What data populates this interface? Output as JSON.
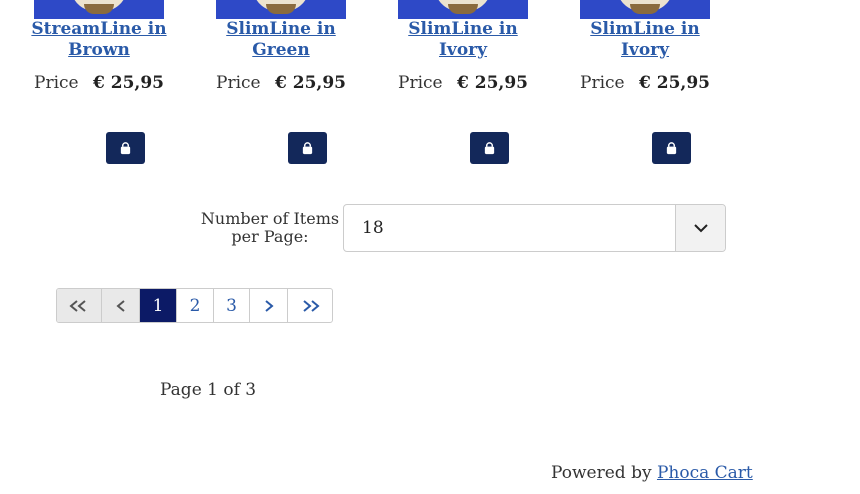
{
  "products": [
    {
      "name": "StreamLine in Brown",
      "price_label": "Price",
      "price": "€ 25,95",
      "cart_icon": "shopping-bag-icon"
    },
    {
      "name": "SlimLine in Green",
      "price_label": "Price",
      "price": "€ 25,95",
      "cart_icon": "shopping-bag-icon"
    },
    {
      "name": "SlimLine in Ivory",
      "price_label": "Price",
      "price": "€ 25,95",
      "cart_icon": "shopping-bag-icon"
    },
    {
      "name": "SlimLine in Ivory",
      "price_label": "Price",
      "price": "€ 25,95",
      "cart_icon": "shopping-bag-icon"
    }
  ],
  "items_per_page": {
    "label": "Number of Items per Page:",
    "value": "18",
    "icon": "chevron-down-icon"
  },
  "pagination": {
    "first_icon": "double-chevron-left-icon",
    "prev_icon": "chevron-left-icon",
    "pages": [
      "1",
      "2",
      "3"
    ],
    "current": "1",
    "next_icon": "chevron-right-icon",
    "last_icon": "double-chevron-right-icon"
  },
  "page_info": "Page 1 of 3",
  "footer": {
    "powered_by": "Powered by",
    "link_text": "Phoca Cart"
  },
  "colors": {
    "link": "#2a5aa8",
    "button": "#13285a",
    "active_page": "#0c1a66",
    "thumb_bg": "#2e49c7"
  }
}
